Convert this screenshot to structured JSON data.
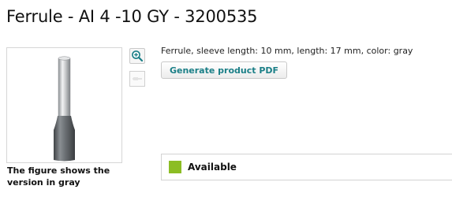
{
  "product": {
    "title": "Ferrule - AI 4 -10 GY - 3200535",
    "description": "Ferrule, sleeve length: 10 mm, length: 17 mm, color: gray",
    "image_caption": "The figure shows the version in gray",
    "generate_pdf_label": "Generate product PDF",
    "availability": "Available"
  },
  "colors": {
    "link_teal": "#1b7f87",
    "available_green": "#8cbd24",
    "ferrule_gray": "#6e7377",
    "sleeve_silver": "#d9dbdd"
  },
  "icons": {
    "zoom": "magnifier-plus-icon",
    "thumbnail": "product-thumbnail-icon",
    "status": "available-status-icon"
  }
}
